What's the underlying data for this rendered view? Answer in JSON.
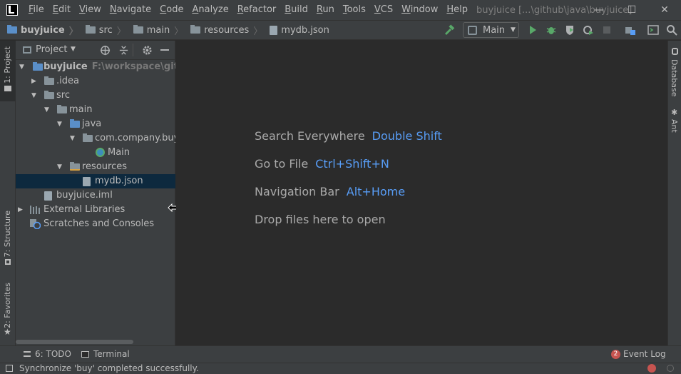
{
  "menu": {
    "items": [
      "File",
      "Edit",
      "View",
      "Navigate",
      "Code",
      "Analyze",
      "Refactor",
      "Build",
      "Run",
      "Tools",
      "VCS",
      "Window",
      "Help"
    ],
    "window_title": "buyjuice [...\\github\\java\\buyjuice]"
  },
  "window_controls": {
    "minimize": "—",
    "maximize": "☐",
    "close": "✕"
  },
  "breadcrumb": [
    "buyjuice",
    "src",
    "main",
    "resources",
    "mydb.json"
  ],
  "run_config": {
    "label": "Main"
  },
  "project_panel": {
    "title": "Project",
    "tree": [
      {
        "label": "buyjuice",
        "hint": "F:\\workspace\\github\\j",
        "depth": 0,
        "expanded": true,
        "icon": "module-folder-icon"
      },
      {
        "label": ".idea",
        "depth": 1,
        "expanded": false,
        "icon": "folder-icon"
      },
      {
        "label": "src",
        "depth": 1,
        "expanded": true,
        "icon": "folder-icon"
      },
      {
        "label": "main",
        "depth": 2,
        "expanded": true,
        "icon": "folder-icon"
      },
      {
        "label": "java",
        "depth": 3,
        "expanded": true,
        "icon": "source-folder-icon"
      },
      {
        "label": "com.company.buy",
        "depth": 4,
        "expanded": true,
        "icon": "package-icon"
      },
      {
        "label": "Main",
        "depth": 5,
        "icon": "java-class-icon"
      },
      {
        "label": "resources",
        "depth": 3,
        "expanded": true,
        "icon": "resources-folder-icon"
      },
      {
        "label": "mydb.json",
        "depth": 4,
        "icon": "json-file-icon",
        "selected": true
      },
      {
        "label": "buyjuice.iml",
        "depth": 1,
        "icon": "iml-file-icon"
      },
      {
        "label": "External Libraries",
        "depth": 0,
        "expanded": false,
        "icon": "libraries-icon"
      },
      {
        "label": "Scratches and Consoles",
        "depth": 0,
        "icon": "scratches-icon"
      }
    ]
  },
  "left_tabs": {
    "project": "1: Project",
    "structure": "7: Structure",
    "favorites": "2: Favorites"
  },
  "right_tabs": {
    "database": "Database",
    "ant": "Ant"
  },
  "editor_hints": [
    {
      "text": "Search Everywhere",
      "key": "Double Shift"
    },
    {
      "text": "Go to File",
      "key": "Ctrl+Shift+N"
    },
    {
      "text": "Navigation Bar",
      "key": "Alt+Home"
    },
    {
      "text": "Drop files here to open",
      "key": ""
    }
  ],
  "bottom_tabs": {
    "todo": "6: TODO",
    "terminal": "Terminal",
    "event_log": "Event Log",
    "event_count": "2"
  },
  "status": {
    "message": "Synchronize 'buy' completed successfully."
  },
  "colors": {
    "accent": "#589df6",
    "selection": "#0d293e",
    "run_green": "#59a869",
    "error_red": "#c75450"
  }
}
